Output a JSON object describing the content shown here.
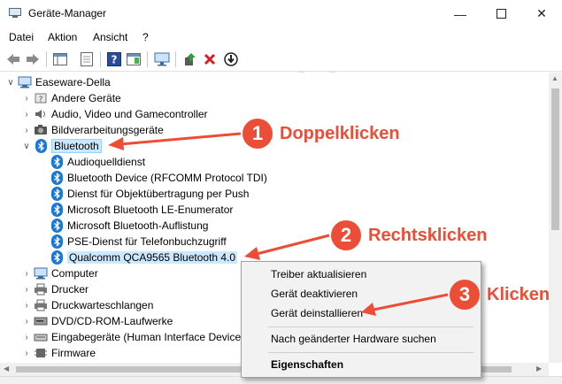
{
  "window": {
    "title": "Geräte-Manager"
  },
  "menu": [
    "Datei",
    "Aktion",
    "Ansicht",
    "?"
  ],
  "watermark": {
    "brand": "driver easy",
    "url": "www.DriverEasy.com"
  },
  "tree": {
    "root": "Easeware-Della",
    "rows": [
      {
        "label": "Andere Geräte",
        "icon": "unknown-device-icon",
        "expanded": false
      },
      {
        "label": "Audio, Video und Gamecontroller",
        "icon": "speaker-icon",
        "expanded": false
      },
      {
        "label": "Bildverarbeitungsgeräte",
        "icon": "camera-icon",
        "expanded": false
      },
      {
        "label": "Bluetooth",
        "icon": "bluetooth-icon",
        "expanded": true,
        "selected": true
      },
      {
        "label": "Audioquelldienst",
        "icon": "bluetooth-icon",
        "child": true
      },
      {
        "label": "Bluetooth Device (RFCOMM Protocol TDI)",
        "icon": "bluetooth-icon",
        "child": true
      },
      {
        "label": "Dienst für Objektübertragung per Push",
        "icon": "bluetooth-icon",
        "child": true
      },
      {
        "label": "Microsoft Bluetooth LE-Enumerator",
        "icon": "bluetooth-icon",
        "child": true
      },
      {
        "label": "Microsoft Bluetooth-Auflistung",
        "icon": "bluetooth-icon",
        "child": true
      },
      {
        "label": "PSE-Dienst für Telefonbuchzugriff",
        "icon": "bluetooth-icon",
        "child": true
      },
      {
        "label": "Qualcomm QCA9565 Bluetooth 4.0",
        "icon": "bluetooth-icon",
        "child": true,
        "highlighted": true
      },
      {
        "label": "Computer",
        "icon": "computer-icon",
        "expanded": false
      },
      {
        "label": "Drucker",
        "icon": "printer-icon",
        "expanded": false
      },
      {
        "label": "Druckwarteschlangen",
        "icon": "printer-icon",
        "expanded": false
      },
      {
        "label": "DVD/CD-ROM-Laufwerke",
        "icon": "disc-drive-icon",
        "expanded": false
      },
      {
        "label": "Eingabegeräte (Human Interface Device",
        "icon": "keyboard-icon",
        "expanded": false
      },
      {
        "label": "Firmware",
        "icon": "chip-icon",
        "expanded": false
      }
    ]
  },
  "context_menu": {
    "items": [
      "Treiber aktualisieren",
      "Gerät deaktivieren",
      "Gerät deinstallieren",
      "Nach geänderter Hardware suchen",
      "Eigenschaften"
    ]
  },
  "annotations": [
    {
      "number": "1",
      "label": "Doppelklicken"
    },
    {
      "number": "2",
      "label": "Rechtsklicken"
    },
    {
      "number": "3",
      "label": "Klicken"
    }
  ],
  "colors": {
    "accent": "#ec4d36",
    "bluetooth": "#1a78d6",
    "selection": "#cce8ff"
  }
}
